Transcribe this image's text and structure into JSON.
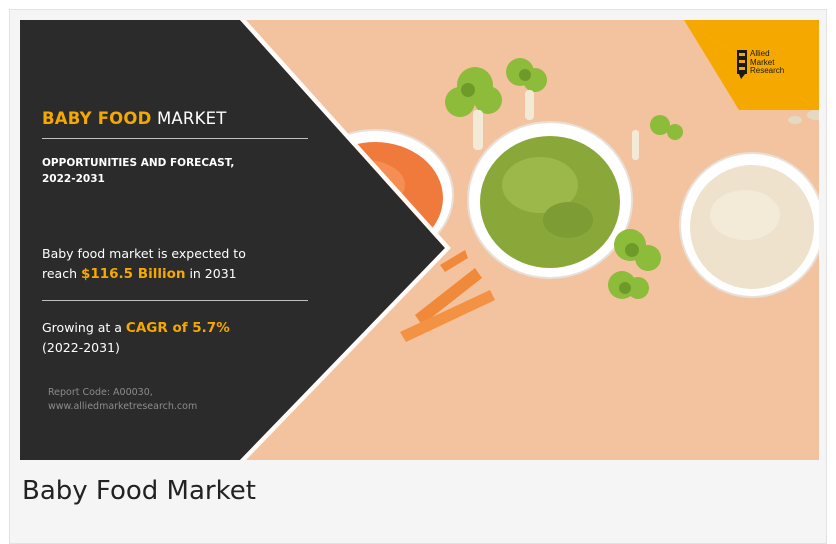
{
  "infographic": {
    "title_highlight": "BABY FOOD",
    "title_rest": " MARKET",
    "subtitle_line1": "OPPORTUNITIES AND FORECAST,",
    "subtitle_line2": "2022-2031",
    "expected_text_1": "Baby food market is expected to",
    "expected_text_2_prefix": "reach ",
    "expected_value": "$116.5 Billion",
    "expected_text_2_suffix": " in 2031",
    "growing_prefix": "Growing at a ",
    "growing_value": "CAGR of 5.7%",
    "growing_period": "(2022-2031)",
    "report_code": "Report Code: A00030,",
    "report_site": "www.alliedmarketresearch.com",
    "logo_line1": "Allied",
    "logo_line2": "Market",
    "logo_line3": "Research"
  },
  "caption": "Baby Food Market",
  "colors": {
    "accent": "#f5a800",
    "panel": "#2b2b2b",
    "background": "#f2c09b"
  }
}
